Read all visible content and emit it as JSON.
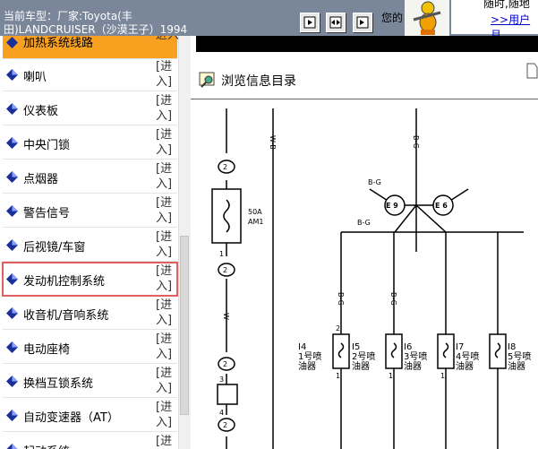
{
  "header": {
    "vehicle_info": "当前车型：厂家:Toyota(丰田)LANDCRUISER（沙漠王子）1994",
    "greeting": "您的",
    "ad_text": "随时,随地",
    "ad_link": ">>用户月"
  },
  "sidebar": {
    "items": [
      {
        "label": "加热系统线路",
        "enter": "进入"
      },
      {
        "label": "喇叭",
        "enter": "[进入]"
      },
      {
        "label": "仪表板",
        "enter": "[进入]"
      },
      {
        "label": "中央门锁",
        "enter": "[进入]"
      },
      {
        "label": "点烟器",
        "enter": "[进入]"
      },
      {
        "label": "警告信号",
        "enter": "[进入]"
      },
      {
        "label": "后视镜/车窗",
        "enter": "[进入]"
      },
      {
        "label": "发动机控制系统",
        "enter": "[进入]"
      },
      {
        "label": "收音机/音响系统",
        "enter": "[进入]"
      },
      {
        "label": "电动座椅",
        "enter": "[进入]"
      },
      {
        "label": "换档互锁系统",
        "enter": "[进入]"
      },
      {
        "label": "自动变速器（AT）",
        "enter": "[进入]"
      },
      {
        "label": "起动系统",
        "enter": "[进"
      }
    ]
  },
  "content": {
    "title": "浏览信息目录",
    "diagram": {
      "wire_labels": [
        "W-B",
        "B-G",
        "B-G",
        "B-G",
        "W",
        "B-G",
        "B-G"
      ],
      "fuse": [
        "50A",
        "AM1"
      ],
      "connectors": [
        "E 9",
        "E 6"
      ],
      "injectors": [
        {
          "id": "I4",
          "name": "1号喷",
          "name2": "油器"
        },
        {
          "id": "I5",
          "name": "2号喷",
          "name2": "油器"
        },
        {
          "id": "I6",
          "name": "3号喷",
          "name2": "油器"
        },
        {
          "id": "I7",
          "name": "4号喷",
          "name2": "油器"
        },
        {
          "id": "I8",
          "name": "5号喷",
          "name2": "油器"
        }
      ],
      "pins": [
        "2",
        "2",
        "1",
        "2",
        "2",
        "3",
        "4",
        "2",
        "1",
        "1",
        "1"
      ]
    }
  },
  "colors": {
    "topbar": "#7a869a",
    "highlight": "#f8a020",
    "selected_outline": "#e06060",
    "diamond": "#1a2f9a"
  }
}
